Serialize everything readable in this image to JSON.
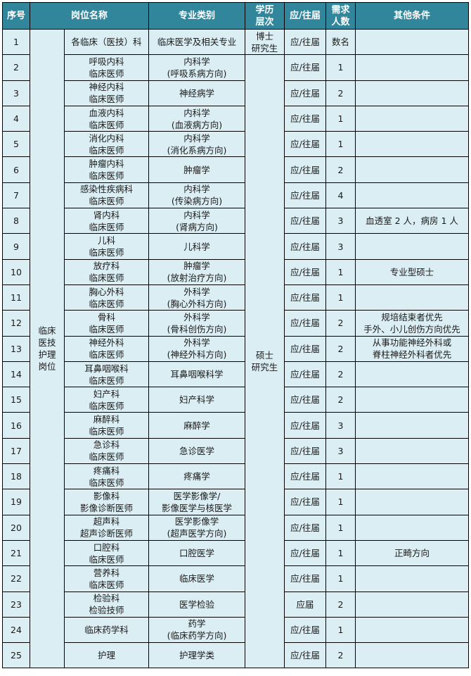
{
  "table": {
    "headers": {
      "seq": "序号",
      "post": "岗位名称",
      "major": "专业类别",
      "edu": [
        "学历",
        "层次"
      ],
      "grad": "应/往届",
      "count": [
        "需求",
        "人数"
      ],
      "other": "其他条件"
    },
    "category_label": [
      "临床",
      "医技",
      "护理",
      "岗位"
    ],
    "edu_groups": {
      "phd": [
        "博士",
        "研究生"
      ],
      "master": [
        "硕士",
        "研究生"
      ]
    },
    "rows": [
      {
        "seq": "1",
        "post": [
          "各临床（医技）科"
        ],
        "major": [
          "临床医学及相关专业"
        ],
        "grad": "应/往届",
        "count": "数名",
        "other": []
      },
      {
        "seq": "2",
        "post": [
          "呼吸内科",
          "临床医师"
        ],
        "major": [
          "内科学",
          "(呼吸系病方向)"
        ],
        "grad": "应/往届",
        "count": "1",
        "other": []
      },
      {
        "seq": "3",
        "post": [
          "神经内科",
          "临床医师"
        ],
        "major": [
          "神经病学"
        ],
        "grad": "应/往届",
        "count": "2",
        "other": []
      },
      {
        "seq": "4",
        "post": [
          "血液内科",
          "临床医师"
        ],
        "major": [
          "内科学",
          "(血液病方向)"
        ],
        "grad": "应/往届",
        "count": "1",
        "other": []
      },
      {
        "seq": "5",
        "post": [
          "消化内科",
          "临床医师"
        ],
        "major": [
          "内科学",
          "(消化系病方向)"
        ],
        "grad": "应/往届",
        "count": "1",
        "other": []
      },
      {
        "seq": "6",
        "post": [
          "肿瘤内科",
          "临床医师"
        ],
        "major": [
          "肿瘤学"
        ],
        "grad": "应/往届",
        "count": "2",
        "other": []
      },
      {
        "seq": "7",
        "post": [
          "感染性疾病科",
          "临床医师"
        ],
        "major": [
          "内科学",
          "(传染病方向)"
        ],
        "grad": "应/往届",
        "count": "4",
        "other": []
      },
      {
        "seq": "8",
        "post": [
          "肾内科",
          "临床医师"
        ],
        "major": [
          "内科学",
          "(肾病方向)"
        ],
        "grad": "应/往届",
        "count": "3",
        "other": [
          "血透室 2 人，病房 1 人"
        ]
      },
      {
        "seq": "9",
        "post": [
          "儿科",
          "临床医师"
        ],
        "major": [
          "儿科学"
        ],
        "grad": "应/往届",
        "count": "3",
        "other": []
      },
      {
        "seq": "10",
        "post": [
          "放疗科",
          "临床医师"
        ],
        "major": [
          "肿瘤学",
          "(放射治疗方向)"
        ],
        "grad": "应/往届",
        "count": "1",
        "other": [
          "专业型硕士"
        ]
      },
      {
        "seq": "11",
        "post": [
          "胸心外科",
          "临床医师"
        ],
        "major": [
          "外科学",
          "(胸心外科方向)"
        ],
        "grad": "应/往届",
        "count": "1",
        "other": []
      },
      {
        "seq": "12",
        "post": [
          "骨科",
          "临床医师"
        ],
        "major": [
          "外科学",
          "(骨科创伤方向)"
        ],
        "grad": "应/往届",
        "count": "2",
        "other": [
          "规培结束者优先",
          "手外、小儿创伤方向优先"
        ]
      },
      {
        "seq": "13",
        "post": [
          "神经外科",
          "临床医师"
        ],
        "major": [
          "外科学",
          "(神经外科方向)"
        ],
        "grad": "应/往届",
        "count": "2",
        "other": [
          "从事功能神经外科或",
          "脊柱神经外科者优先"
        ]
      },
      {
        "seq": "14",
        "post": [
          "耳鼻咽喉科",
          "临床医师"
        ],
        "major": [
          "耳鼻咽喉科学"
        ],
        "grad": "应/往届",
        "count": "2",
        "other": []
      },
      {
        "seq": "15",
        "post": [
          "妇产科",
          "临床医师"
        ],
        "major": [
          "妇产科学"
        ],
        "grad": "应/往届",
        "count": "2",
        "other": []
      },
      {
        "seq": "16",
        "post": [
          "麻醉科",
          "临床医师"
        ],
        "major": [
          "麻醉学"
        ],
        "grad": "应/往届",
        "count": "3",
        "other": []
      },
      {
        "seq": "17",
        "post": [
          "急诊科",
          "临床医师"
        ],
        "major": [
          "急诊医学"
        ],
        "grad": "应/往届",
        "count": "3",
        "other": []
      },
      {
        "seq": "18",
        "post": [
          "疼痛科",
          "临床医师"
        ],
        "major": [
          "疼痛学"
        ],
        "grad": "应/往届",
        "count": "1",
        "other": []
      },
      {
        "seq": "19",
        "post": [
          "影像科",
          "影像诊断医师"
        ],
        "major": [
          "医学影像学/",
          "影像医学与核医学"
        ],
        "grad": "应/往届",
        "count": "1",
        "other": []
      },
      {
        "seq": "20",
        "post": [
          "超声科",
          "超声诊断医师"
        ],
        "major": [
          "医学影像学",
          "(超声医学方向)"
        ],
        "grad": "应/往届",
        "count": "1",
        "other": []
      },
      {
        "seq": "21",
        "post": [
          "口腔科",
          "临床医师"
        ],
        "major": [
          "口腔医学"
        ],
        "grad": "应/往届",
        "count": "1",
        "other": [
          "正畸方向"
        ]
      },
      {
        "seq": "22",
        "post": [
          "营养科",
          "临床医师"
        ],
        "major": [
          "临床医学"
        ],
        "grad": "应/往届",
        "count": "1",
        "other": []
      },
      {
        "seq": "23",
        "post": [
          "检验科",
          "检验技师"
        ],
        "major": [
          "医学检验"
        ],
        "grad": "应届",
        "count": "2",
        "other": []
      },
      {
        "seq": "24",
        "post": [
          "临床药学科"
        ],
        "major": [
          "药学",
          "(临床药学方向)"
        ],
        "grad": "应/往届",
        "count": "1",
        "other": []
      },
      {
        "seq": "25",
        "post": [
          "护理"
        ],
        "major": [
          "护理学类"
        ],
        "grad": "应/往届",
        "count": "2",
        "other": []
      }
    ]
  }
}
